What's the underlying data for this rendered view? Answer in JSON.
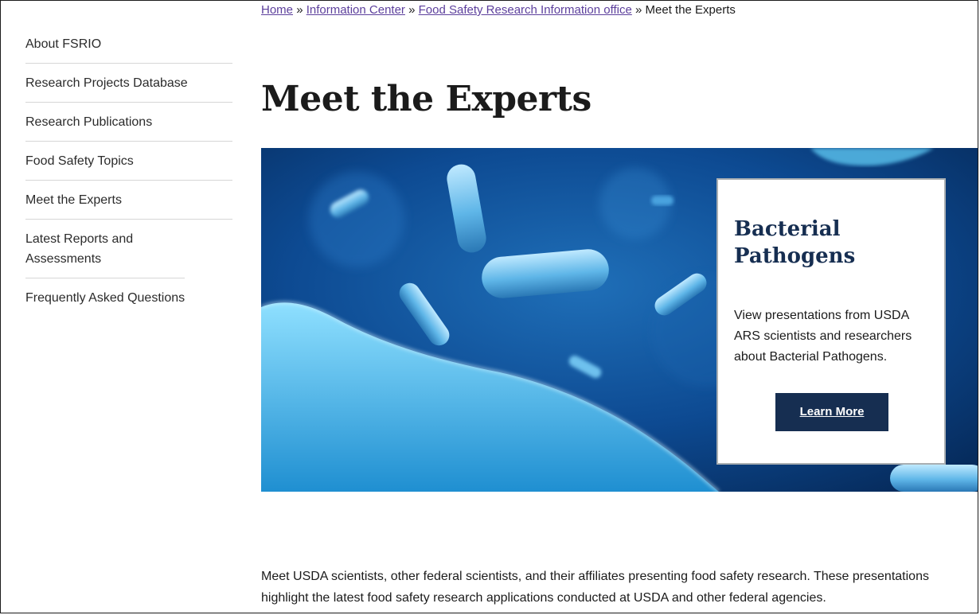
{
  "breadcrumb": {
    "items": [
      "Home",
      "Information Center",
      "Food Safety Research Information office"
    ],
    "current": "Meet the Experts",
    "separator": "»"
  },
  "sidebar": {
    "items": [
      {
        "label": "About FSRIO"
      },
      {
        "label": "Research Projects Database"
      },
      {
        "label": "Research Publications"
      },
      {
        "label": "Food Safety Topics"
      },
      {
        "label": "Meet the Experts"
      },
      {
        "label": "Latest Reports and Assessments"
      },
      {
        "label": "Frequently Asked Questions"
      }
    ]
  },
  "page": {
    "title": "Meet the Experts"
  },
  "hero": {
    "card_title": "Bacterial Pathogens",
    "card_text": "View presentations from USDA ARS scientists and researchers about Bacterial Pathogens.",
    "button_label": "Learn More"
  },
  "intro": {
    "text": "Meet USDA scientists, other federal scientists, and their affiliates presenting food safety research. These presentations highlight the latest food safety research applications conducted at USDA and other federal agencies."
  },
  "colors": {
    "link": "#5c3f9c",
    "navy": "#162e51",
    "hero_blue": "#0b3b7a"
  }
}
